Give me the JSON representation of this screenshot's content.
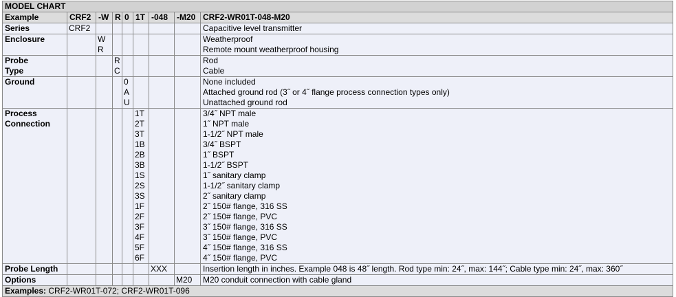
{
  "title": "MODEL CHART",
  "example": {
    "label": "Example",
    "codes": [
      "CRF2",
      "-W",
      "R",
      "0",
      "1T",
      "-048",
      "-M20"
    ],
    "model": "CRF2-WR01T-048-M20"
  },
  "sections": [
    {
      "label_lines": [
        "Series"
      ],
      "cols": [
        [
          "CRF2"
        ],
        [],
        [],
        [],
        [],
        [],
        []
      ],
      "descriptions": [
        "Capacitive level transmitter"
      ]
    },
    {
      "label_lines": [
        "Enclosure"
      ],
      "cols": [
        [],
        [
          "W",
          "R"
        ],
        [],
        [],
        [],
        [],
        []
      ],
      "descriptions": [
        "Weatherproof",
        "Remote mount weatherproof housing"
      ]
    },
    {
      "label_lines": [
        "Probe",
        "Type"
      ],
      "cols": [
        [],
        [],
        [
          "R",
          "C"
        ],
        [],
        [],
        [],
        []
      ],
      "descriptions": [
        "Rod",
        "Cable"
      ]
    },
    {
      "label_lines": [
        "Ground"
      ],
      "cols": [
        [],
        [],
        [],
        [
          "0",
          "A",
          "U"
        ],
        [],
        [],
        []
      ],
      "descriptions": [
        "None included",
        "Attached ground rod (3˝ or 4˝ flange process connection types only)",
        "Unattached ground rod"
      ]
    },
    {
      "label_lines": [
        "Process",
        "Connection"
      ],
      "cols": [
        [],
        [],
        [],
        [],
        [
          "1T",
          "2T",
          "3T",
          "1B",
          "2B",
          "3B",
          "1S",
          "2S",
          "3S",
          "1F",
          "2F",
          "3F",
          "4F",
          "5F",
          "6F"
        ],
        [],
        []
      ],
      "descriptions": [
        "3/4˝ NPT male",
        "1˝ NPT male",
        "1-1/2˝ NPT male",
        "3/4˝ BSPT",
        "1˝ BSPT",
        "1-1/2˝ BSPT",
        "1˝ sanitary clamp",
        "1-1/2˝ sanitary clamp",
        "2˝ sanitary clamp",
        "2˝ 150# flange, 316 SS",
        "2˝ 150# flange, PVC",
        "3˝ 150# flange, 316 SS",
        "3˝ 150# flange, PVC",
        "4˝ 150# flange, 316 SS",
        "4˝ 150# flange, PVC"
      ]
    },
    {
      "label_lines": [
        "Probe Length"
      ],
      "cols": [
        [],
        [],
        [],
        [],
        [],
        [
          "XXX"
        ],
        []
      ],
      "descriptions": [
        "Insertion length in inches. Example 048 is 48˝ length. Rod type min: 24˝, max: 144˝; Cable type min: 24˝, max: 360˝"
      ]
    },
    {
      "label_lines": [
        "Options"
      ],
      "cols": [
        [],
        [],
        [],
        [],
        [],
        [],
        [
          "M20"
        ]
      ],
      "descriptions": [
        "M20 conduit connection with cable gland"
      ]
    }
  ],
  "footer": {
    "label": "Examples:",
    "text": " CRF2-WR01T-072; CRF2-WR01T-096"
  }
}
